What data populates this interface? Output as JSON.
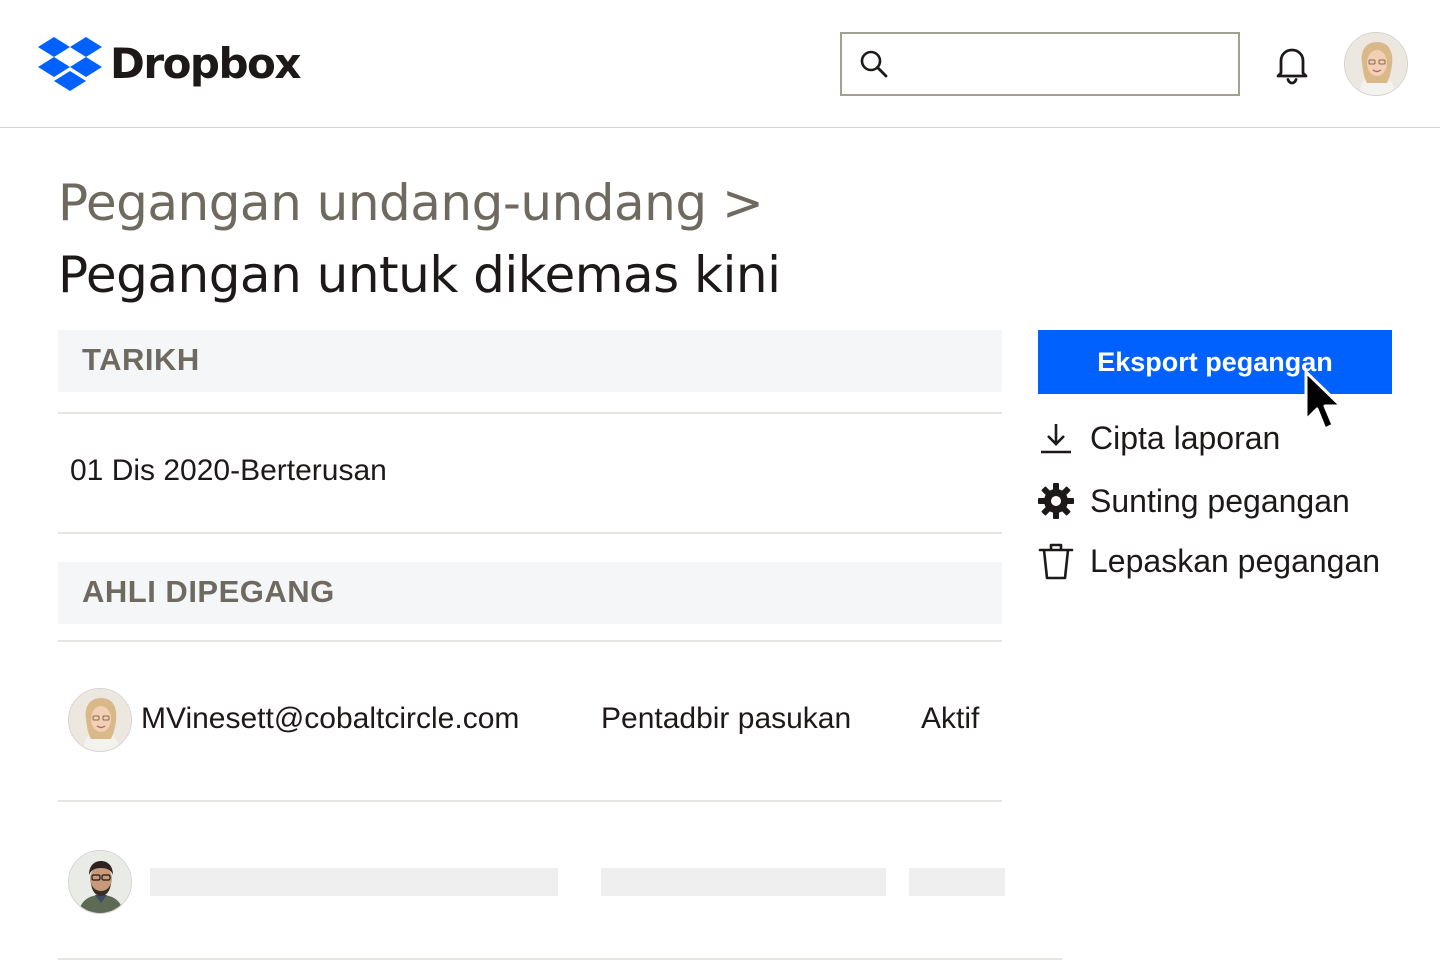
{
  "header": {
    "brand": "Dropbox",
    "search": {
      "value": "",
      "placeholder": ""
    }
  },
  "breadcrumb": {
    "parent": "Pegangan undang-undang >"
  },
  "page": {
    "title": "Pegangan untuk dikemas kini"
  },
  "table": {
    "date_header": "TARIKH",
    "date_value": "01 Dis 2020-Berterusan",
    "members_header": "AHLI DIPEGANG",
    "members": [
      {
        "email": "MVinesett@cobaltcircle.com",
        "role": "Pentadbir pasukan",
        "status": "Aktif"
      }
    ]
  },
  "actions": {
    "export": "Eksport pegangan",
    "report": "Cipta laporan",
    "edit": "Sunting pegangan",
    "release": "Lepaskan pegangan"
  },
  "colors": {
    "accent": "#0061fe",
    "text": "#1e1919",
    "muted": "#6f6a60",
    "section_bg": "#f5f6f8",
    "skeleton": "#efefef"
  },
  "icons": [
    "dropbox-logo-icon",
    "search-icon",
    "bell-icon",
    "download-icon",
    "gear-icon",
    "trash-icon",
    "mouse-cursor-icon"
  ]
}
